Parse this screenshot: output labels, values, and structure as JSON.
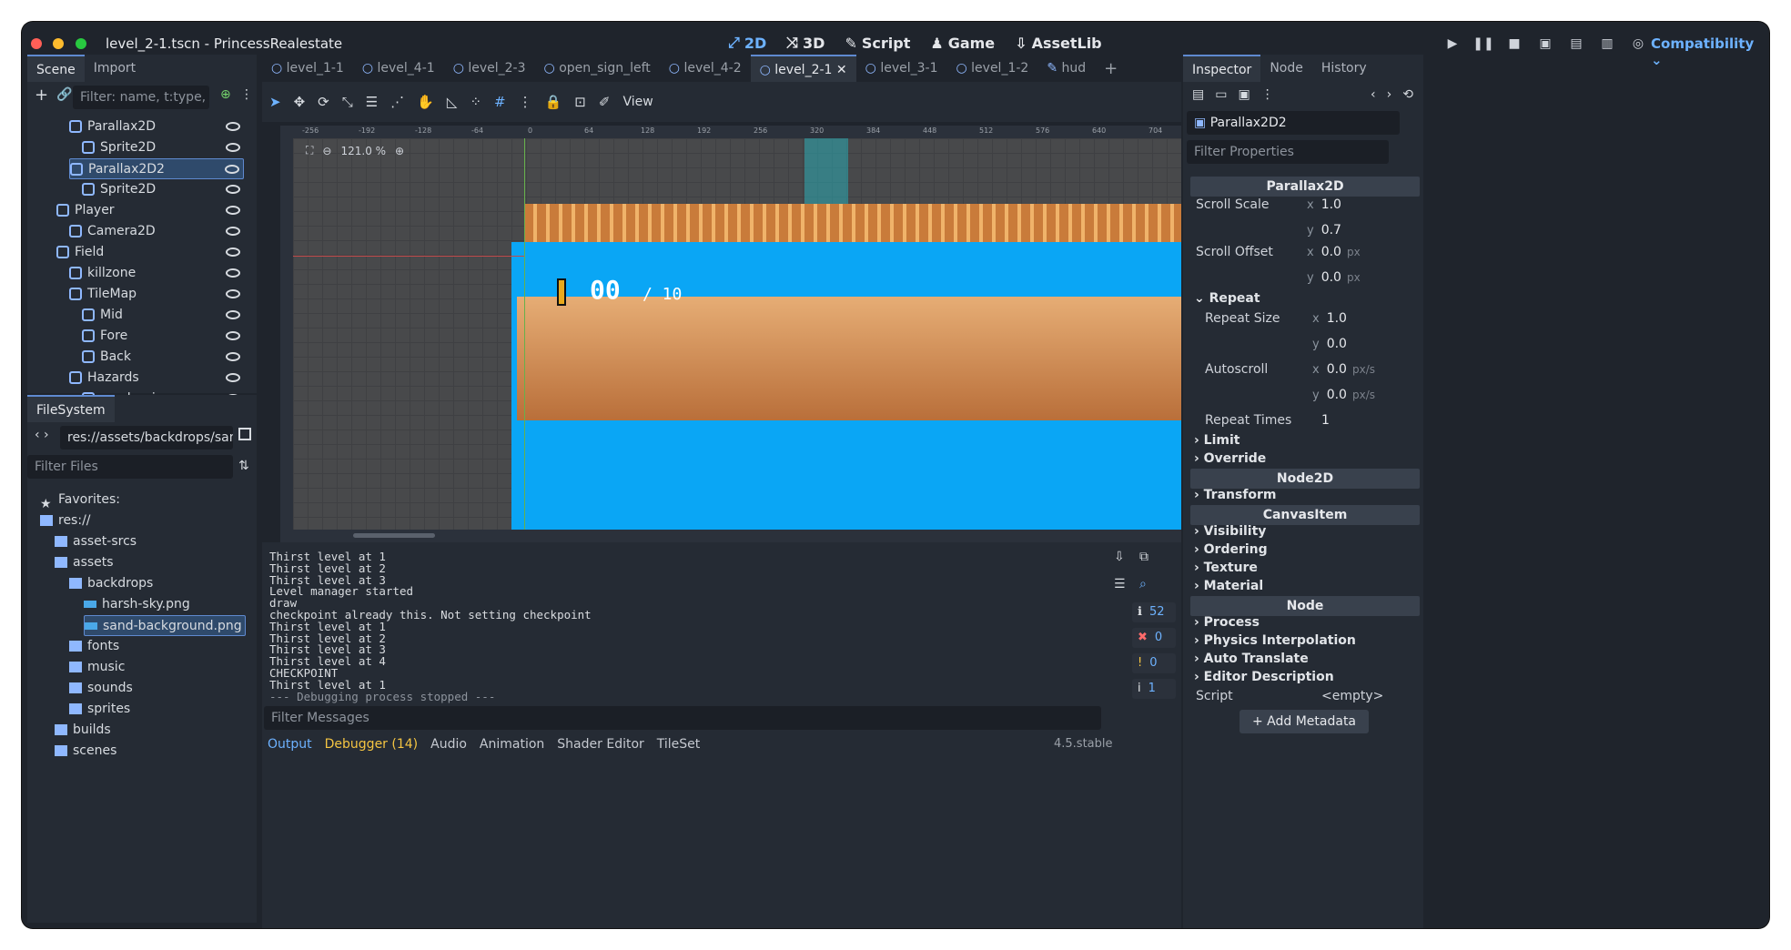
{
  "window": {
    "title": "level_2-1.tscn - PrincessRealestate",
    "modes": [
      {
        "icon": "2d-icon",
        "label": "2D",
        "active": true
      },
      {
        "icon": "3d-icon",
        "label": "3D"
      },
      {
        "icon": "script-icon",
        "label": "Script"
      },
      {
        "icon": "game-icon",
        "label": "Game"
      },
      {
        "icon": "assetlib-icon",
        "label": "AssetLib"
      }
    ],
    "renderer": "Compatibility"
  },
  "scene_dock": {
    "tabs": [
      "Scene",
      "Import"
    ],
    "filter_placeholder": "Filter: name, t:type, g:g",
    "nodes": [
      {
        "label": "Parallax2D",
        "indent": 2
      },
      {
        "label": "Sprite2D",
        "indent": 3
      },
      {
        "label": "Parallax2D2",
        "indent": 2,
        "selected": true
      },
      {
        "label": "Sprite2D",
        "indent": 3
      },
      {
        "label": "Player",
        "indent": 1
      },
      {
        "label": "Camera2D",
        "indent": 2
      },
      {
        "label": "Field",
        "indent": 1
      },
      {
        "label": "killzone",
        "indent": 2
      },
      {
        "label": "TileMap",
        "indent": 2
      },
      {
        "label": "Mid",
        "indent": 3
      },
      {
        "label": "Fore",
        "indent": 3
      },
      {
        "label": "Back",
        "indent": 3
      },
      {
        "label": "Hazards",
        "indent": 2
      },
      {
        "label": "sand_spinner",
        "indent": 3
      }
    ]
  },
  "filesystem": {
    "tab": "FileSystem",
    "path": "res://assets/backdrops/sand-back",
    "filter_placeholder": "Filter Files",
    "items": [
      {
        "label": "Favorites:",
        "indent": 0
      },
      {
        "label": "res://",
        "indent": 0
      },
      {
        "label": "asset-srcs",
        "indent": 1
      },
      {
        "label": "assets",
        "indent": 1
      },
      {
        "label": "backdrops",
        "indent": 2
      },
      {
        "label": "harsh-sky.png",
        "indent": 3
      },
      {
        "label": "sand-background.png",
        "indent": 3,
        "selected": true
      },
      {
        "label": "fonts",
        "indent": 2
      },
      {
        "label": "music",
        "indent": 2
      },
      {
        "label": "sounds",
        "indent": 2
      },
      {
        "label": "sprites",
        "indent": 2
      },
      {
        "label": "builds",
        "indent": 1
      },
      {
        "label": "scenes",
        "indent": 1
      }
    ]
  },
  "editor_tabs": [
    "level_1-1",
    "level_4-1",
    "level_2-3",
    "open_sign_left",
    "level_4-2",
    "level_2-1",
    "level_3-1",
    "level_1-2",
    "hud"
  ],
  "active_tab": "level_2-1",
  "toolbar": {
    "view_label": "View"
  },
  "canvas": {
    "zoom": "121.0 %",
    "ruler_labels": [
      "-256",
      "-192",
      "-128",
      "-64",
      "0",
      "64",
      "128",
      "192",
      "256",
      "320",
      "384",
      "448",
      "512",
      "576",
      "640",
      "704"
    ],
    "hud_counter": "00",
    "hud_total": "/ 10"
  },
  "output": {
    "lines": [
      "Thirst level at 1",
      "Thirst level at 2",
      "Thirst level at 3",
      "Level manager started",
      "draw",
      "checkpoint already this. Not setting checkpoint",
      "Thirst level at 1",
      "Thirst level at 2",
      "Thirst level at 3",
      "Thirst level at 4",
      "CHECKPOINT",
      "Thirst level at 1",
      "--- Debugging process stopped ---"
    ],
    "filter_placeholder": "Filter Messages",
    "counts": {
      "messages": "52",
      "errors": "0",
      "warnings": "0",
      "info": "1"
    }
  },
  "bottom_tabs": [
    "Output",
    "Debugger (14)",
    "Audio",
    "Animation",
    "Shader Editor",
    "TileSet"
  ],
  "version": "4.5.stable",
  "inspector": {
    "tabs": [
      "Inspector",
      "Node",
      "History"
    ],
    "node_name": "Parallax2D2",
    "filter_placeholder": "Filter Properties",
    "class_header": "Parallax2D",
    "scroll_scale_label": "Scroll Scale",
    "scroll_scale_x": "1.0",
    "scroll_scale_y": "0.7",
    "scroll_offset_label": "Scroll Offset",
    "scroll_offset_x": "0.0",
    "scroll_offset_y": "0.0",
    "px": "px",
    "repeat_label": "Repeat",
    "repeat_size_label": "Repeat Size",
    "repeat_size_x": "1.0",
    "repeat_size_y": "0.0",
    "autoscroll_label": "Autoscroll",
    "autoscroll_x": "0.0",
    "autoscroll_y": "0.0",
    "pxs": "px/s",
    "repeat_times_label": "Repeat Times",
    "repeat_times": "1",
    "limit": "Limit",
    "override": "Override",
    "node2d_header": "Node2D",
    "transform": "Transform",
    "canvasitem_header": "CanvasItem",
    "visibility": "Visibility",
    "ordering": "Ordering",
    "texture": "Texture",
    "material": "Material",
    "node_header": "Node",
    "process": "Process",
    "physics_interpolation": "Physics Interpolation",
    "auto_translate": "Auto Translate",
    "editor_description": "Editor Description",
    "script_label": "Script",
    "script_value": "<empty>",
    "add_metadata": "Add Metadata"
  },
  "colors": {
    "accent": "#6db2ff",
    "sky": "#0aa6f5",
    "sand": "#c98a53"
  }
}
